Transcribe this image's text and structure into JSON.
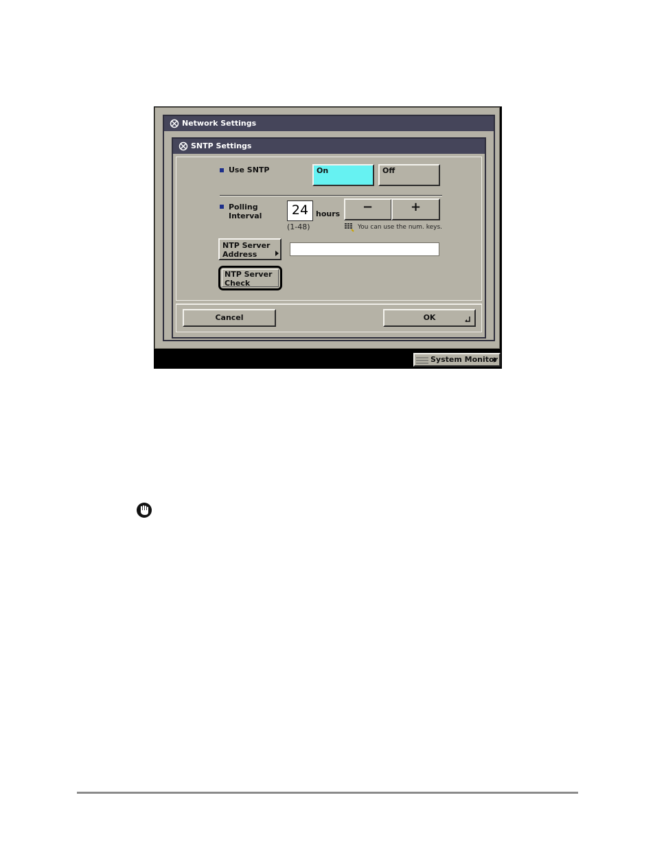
{
  "screen": {
    "outer_title": "Network Settings",
    "inner_title": "SNTP Settings",
    "use_sntp": {
      "label": "Use SNTP",
      "on_label": "On",
      "off_label": "Off",
      "selected": "On"
    },
    "polling": {
      "label_line1": "Polling",
      "label_line2": "Interval",
      "value": "24",
      "unit": "hours",
      "range": "(1-48)",
      "minus_label": "−",
      "plus_label": "+",
      "hint": "You can use the num. keys."
    },
    "ntp_address": {
      "label_line1": "NTP Server",
      "label_line2": "Address",
      "value": ""
    },
    "ntp_check": {
      "label_line1": "NTP Server",
      "label_line2": "Check"
    },
    "footer": {
      "cancel_label": "Cancel",
      "ok_label": "OK"
    },
    "status": {
      "system_monitor_label": "System Monitor"
    }
  },
  "colors": {
    "panel": "#b5b2a6",
    "titlebar": "#45455a",
    "selected": "#66f2f2",
    "bullet": "#1d2f8a"
  },
  "icons": [
    "settings-icon",
    "keypad-icon",
    "hand-stop-icon",
    "enter-icon",
    "arrow-right-icon"
  ]
}
